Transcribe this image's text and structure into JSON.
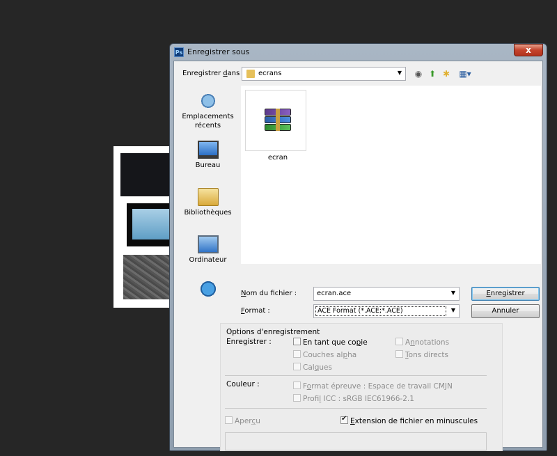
{
  "window": {
    "title": "Enregistrer sous",
    "app_icon": "Ps",
    "close_glyph": "x"
  },
  "lookin": {
    "label_pre": "Enregistrer ",
    "label_ul": "d",
    "label_post": "ans :",
    "value": "ecrans",
    "nav_icons": [
      "back-icon",
      "up-folder-icon",
      "new-folder-icon",
      "view-menu-icon"
    ]
  },
  "places": [
    {
      "label": "Emplacements récents",
      "icon": "recent-places-icon"
    },
    {
      "label": "Bureau",
      "icon": "desktop-icon"
    },
    {
      "label": "Bibliothèques",
      "icon": "libraries-icon"
    },
    {
      "label": "Ordinateur",
      "icon": "computer-icon"
    },
    {
      "label": "",
      "icon": "network-icon"
    }
  ],
  "files": [
    {
      "name": "ecran",
      "icon": "winrar-archive-icon"
    }
  ],
  "filename": {
    "label_ul": "N",
    "label_post": "om du fichier :",
    "value": "ecran.ace"
  },
  "format": {
    "label_ul": "F",
    "label_post": "ormat :",
    "value": "ACE Format (*.ACE;*.ACE)"
  },
  "buttons": {
    "save_ul": "E",
    "save_post": "nregistrer",
    "cancel": "Annuler"
  },
  "options": {
    "title": "Options d'enregistrement",
    "save_label": "Enregistrer :",
    "as_copy": {
      "pre": "En tant que co",
      "ul": "p",
      "post": "ie",
      "checked": false
    },
    "alpha": {
      "pre": "Couches al",
      "ul": "p",
      "post": "ha",
      "checked": false
    },
    "layers": {
      "pre": "Cal",
      "ul": "q",
      "post": "ues",
      "checked": false
    },
    "annotations": {
      "pre": "A",
      "ul": "n",
      "post": "notations",
      "checked": false
    },
    "spot": {
      "pre": "",
      "ul": "T",
      "post": "ons directs",
      "checked": false
    },
    "color_label": "Couleur :",
    "proof": {
      "pre": "F",
      "ul": "o",
      "post": "rmat épreuve : Espace de travail CMJN",
      "checked": false
    },
    "icc": {
      "pre": "Profi",
      "ul": "l",
      "post": " ICC : sRGB IEC61966-2.1",
      "checked": false
    },
    "preview": {
      "pre": "Aper",
      "ul": "ç",
      "post": "u",
      "checked": false
    },
    "lowercase": {
      "pre": "",
      "ul": "E",
      "post": "xtension de fichier en minuscules",
      "checked": true
    }
  },
  "colors": {
    "desktop_bg": "#262626",
    "titlebar": "#a9b6c4",
    "close_button": "#c4432c",
    "client_bg": "#f0f0f0"
  }
}
